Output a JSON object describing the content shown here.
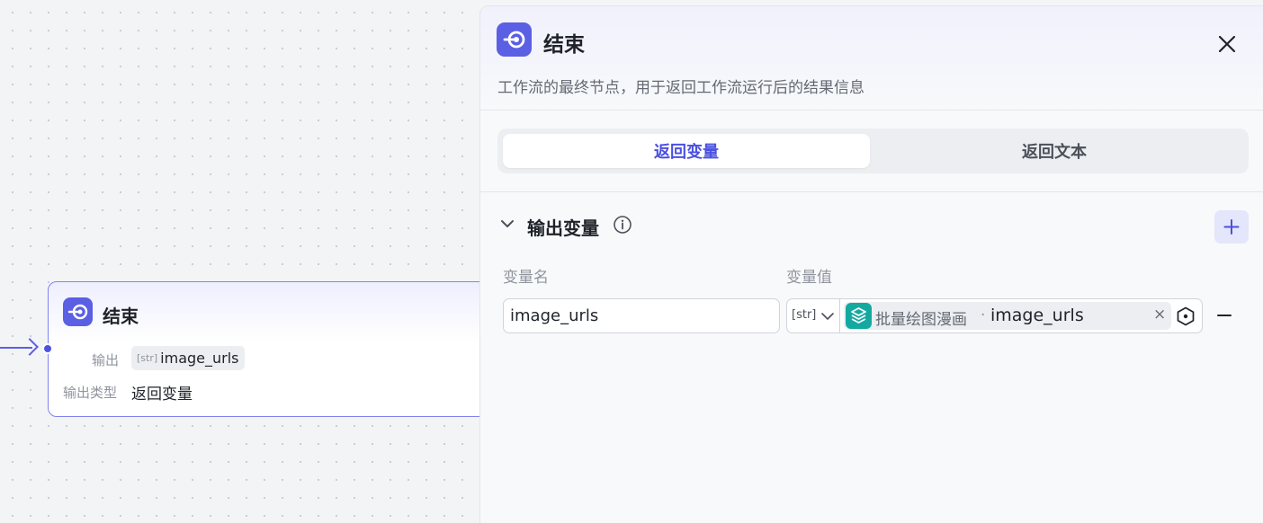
{
  "node": {
    "title": "结束",
    "output_label": "输出",
    "output_type_tag": "[str]",
    "output_value": "image_urls",
    "output_type_label": "输出类型",
    "output_type_value": "返回变量"
  },
  "panel": {
    "title": "结束",
    "description": "工作流的最终节点，用于返回工作流运行后的结果信息",
    "tabs": [
      {
        "label": "返回变量",
        "active": true
      },
      {
        "label": "返回文本",
        "active": false
      }
    ],
    "section": {
      "title": "输出变量",
      "col_name_label": "变量名",
      "col_value_label": "变量值",
      "rows": [
        {
          "name": "image_urls",
          "type": "[str]",
          "ref_source": "批量绘图漫画",
          "ref_separator": "·",
          "ref_variable": "image_urls"
        }
      ]
    }
  },
  "colors": {
    "accent": "#5b5fe3",
    "ref_icon": "#14a9a0"
  },
  "icons": {
    "node_icon": "end-node-icon",
    "close": "close-icon",
    "chevron": "chevron-down-icon",
    "info": "info-icon",
    "add": "plus-icon",
    "remove": "minus-icon",
    "ref": "layers-icon",
    "picker": "variable-picker-icon"
  }
}
